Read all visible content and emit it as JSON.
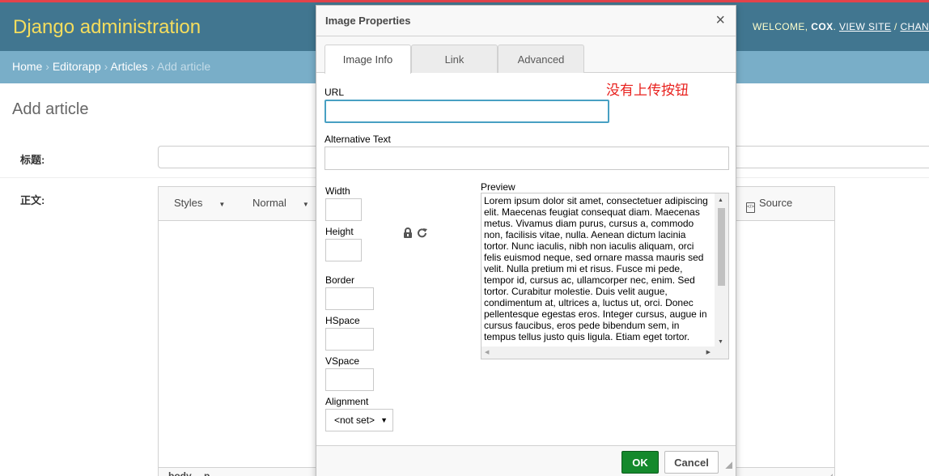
{
  "admin": {
    "branding": "Django administration",
    "welcome": "WELCOME,",
    "username": "COX",
    "view_site": "VIEW SITE",
    "slash": "/",
    "change": "CHANGE",
    "breadcrumbs": [
      "Home",
      "Editorapp",
      "Articles",
      "Add article"
    ],
    "breadcrumb_sep": "›",
    "page_title": "Add article",
    "field_title_label": "标题:",
    "field_body_label": "正文:"
  },
  "editor": {
    "styles_label": "Styles",
    "format_label": "Normal",
    "source_label": "Source",
    "path": [
      "body",
      "p"
    ]
  },
  "dialog": {
    "title": "Image Properties",
    "close_symbol": "×",
    "tabs": [
      {
        "label": "Image Info",
        "active": true
      },
      {
        "label": "Link",
        "active": false
      },
      {
        "label": "Advanced",
        "active": false
      }
    ],
    "url_label": "URL",
    "url_value": "",
    "alt_label": "Alternative Text",
    "alt_value": "",
    "width_label": "Width",
    "height_label": "Height",
    "border_label": "Border",
    "hspace_label": "HSpace",
    "vspace_label": "VSpace",
    "alignment_label": "Alignment",
    "alignment_value": "<not set>",
    "preview_label": "Preview",
    "preview_text": "Lorem ipsum dolor sit amet, consectetuer adipiscing elit. Maecenas feugiat consequat diam. Maecenas metus. Vivamus diam purus, cursus a, commodo non, facilisis vitae, nulla. Aenean dictum lacinia tortor. Nunc iaculis, nibh non iaculis aliquam, orci felis euismod neque, sed ornare massa mauris sed velit. Nulla pretium mi et risus. Fusce mi pede, tempor id, cursus ac, ullamcorper nec, enim. Sed tortor. Curabitur molestie. Duis velit augue, condimentum at, ultrices a, luctus ut, orci. Donec pellentesque egestas eros. Integer cursus, augue in cursus faucibus, eros pede bibendum sem, in tempus tellus justo quis ligula. Etiam eget tortor.",
    "ok_label": "OK",
    "cancel_label": "Cancel",
    "annotation": "没有上传按钮"
  },
  "colors": {
    "header_bg": "#417690",
    "breadcrumb_bg": "#79aec8",
    "branding": "#f5dd5d",
    "ok_button": "#14892c",
    "focus_border": "#48a0c3",
    "annotation": "#e8211e"
  }
}
